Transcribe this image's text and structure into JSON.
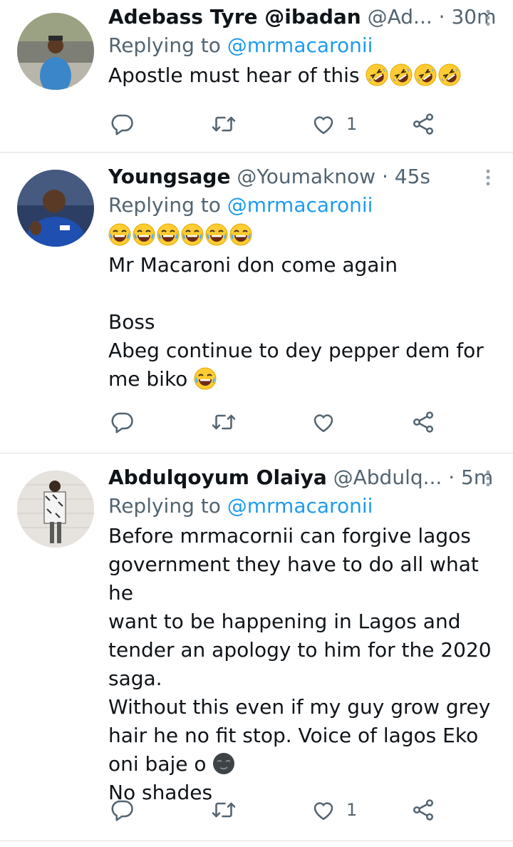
{
  "tweets": [
    {
      "name": "Adebass Tyre @ibadan",
      "handle": "@Ad...",
      "time": "· 30m",
      "replying_prefix": "Replying to ",
      "replying_handle": "@mrmacaronii",
      "text": "Apostle must hear of this",
      "text_emoji": [
        "rolling-on-floor-laughing",
        "rolling-on-floor-laughing",
        "rolling-on-floor-laughing",
        "rolling-on-floor-laughing"
      ],
      "likes": "1"
    },
    {
      "name": "Youngsage",
      "handle": "@Youmaknow",
      "time": "· 45s",
      "replying_prefix": "Replying to ",
      "replying_handle": "@mrmacaronii",
      "lead_emoji": [
        "face-with-tears-of-joy",
        "face-with-tears-of-joy",
        "face-with-tears-of-joy",
        "face-with-tears-of-joy",
        "face-with-tears-of-joy",
        "face-with-tears-of-joy"
      ],
      "text": "Mr Macaroni don come again\n\nBoss\nAbeg continue to dey pepper dem for\nme biko",
      "text_emoji": [
        "face-with-tears-of-joy"
      ],
      "likes": ""
    },
    {
      "name": "Abdulqoyum Olaiya",
      "handle": "@Abdulq...",
      "time": "· 5m",
      "replying_prefix": "Replying to ",
      "replying_handle": "@mrmacaronii",
      "text_a": "Before mrmacornii can forgive lagos\ngovernment they have to do all what he\nwant to be happening in Lagos and\ntender an apology to him for the 2020\nsaga.\nWithout this even if my guy grow grey\nhair he no fit stop. Voice of lagos Eko\noni baje o",
      "mid_emoji": [
        "new-moon-face"
      ],
      "text_b": "No shades",
      "likes": "1"
    }
  ],
  "colors": {
    "accent": "#1d9bf0",
    "secondary_text": "#536471",
    "primary_text": "#0f1419",
    "divider": "#d9dde1"
  },
  "icons": [
    "reply-icon",
    "retweet-icon",
    "like-icon",
    "share-icon",
    "more-options-icon"
  ]
}
